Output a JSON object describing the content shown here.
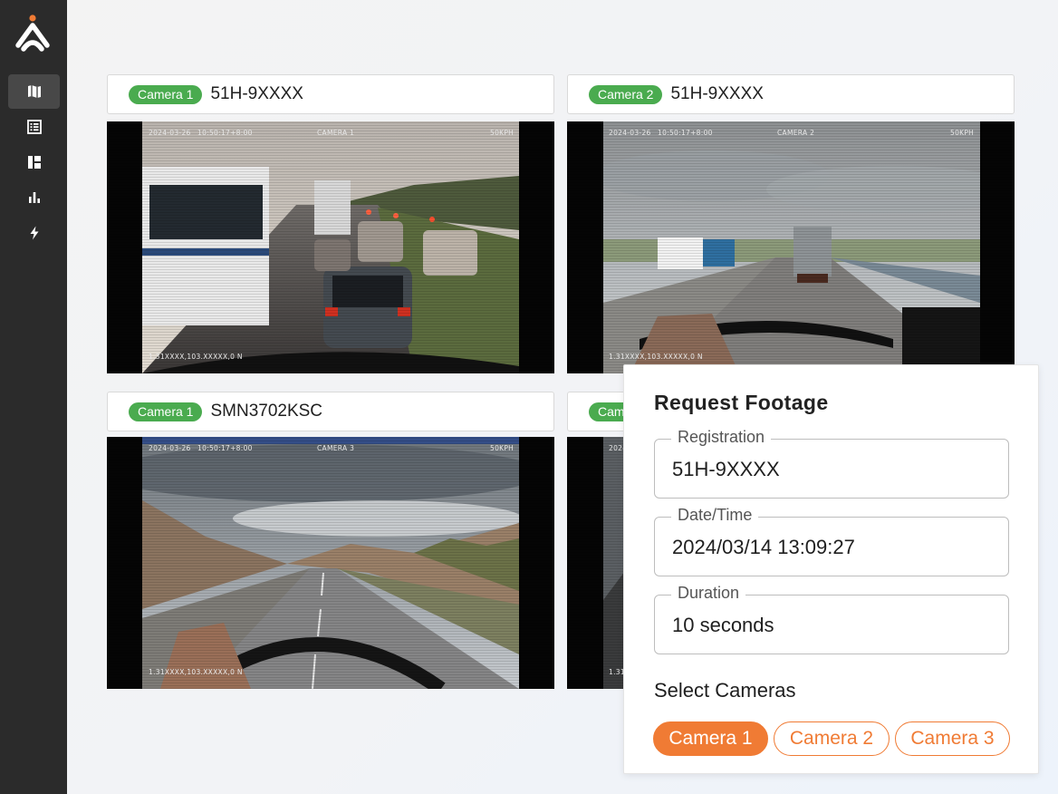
{
  "sidebar": {
    "logo": "tracking-logo",
    "items": [
      {
        "icon": "map-icon",
        "active": true
      },
      {
        "icon": "list-icon",
        "active": false
      },
      {
        "icon": "dashboard-icon",
        "active": false
      },
      {
        "icon": "bar-chart-icon",
        "active": false
      },
      {
        "icon": "lightning-icon",
        "active": false
      }
    ]
  },
  "feeds": [
    {
      "badge": "Camera 1",
      "plate": "51H-9XXXX",
      "date": "2024-03-26",
      "time": "10:50:17+8:00",
      "camera": "CAMERA 1",
      "speed": "50KPH",
      "gps": "1.31XXXX,103.XXXXX,0 N"
    },
    {
      "badge": "Camera 2",
      "plate": "51H-9XXXX",
      "date": "2024-03-26",
      "time": "10:50:17+8:00",
      "camera": "CAMERA 2",
      "speed": "50KPH",
      "gps": "1.31XXXX,103.XXXXX,0 N"
    },
    {
      "badge": "Camera 1",
      "plate": "SMN3702KSC",
      "date": "2024-03-26",
      "time": "10:50:17+8:00",
      "camera": "CAMERA 3",
      "speed": "50KPH",
      "gps": "1.31XXXX,103.XXXXX,0 N"
    },
    {
      "badge": "Cam",
      "date": "2024",
      "gps": "1.31"
    }
  ],
  "request": {
    "title": "Request Footage",
    "registration": {
      "label": "Registration",
      "value": "51H-9XXXX"
    },
    "datetime": {
      "label": "Date/Time",
      "value": "2024/03/14 13:09:27"
    },
    "duration": {
      "label": "Duration",
      "value": "10 seconds"
    },
    "select_label": "Select Cameras",
    "cameras": [
      {
        "label": "Camera 1",
        "selected": true
      },
      {
        "label": "Camera 2",
        "selected": false
      },
      {
        "label": "Camera 3",
        "selected": false
      }
    ]
  },
  "colors": {
    "sidebar": "#2b2b2b",
    "badge": "#4aab4f",
    "accent": "#f07b34"
  }
}
